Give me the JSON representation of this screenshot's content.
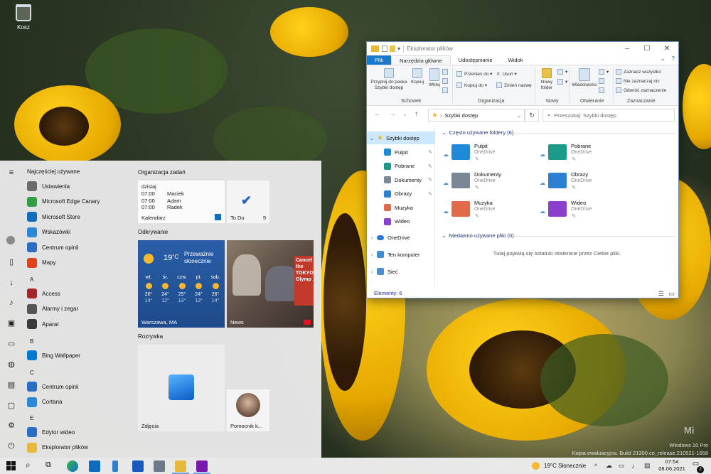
{
  "desktop": {
    "recycle_bin_label": "Kosz"
  },
  "watermark": {
    "line1": "Windows 10 Pro",
    "line2": "Kopia ewaluacyjna. Build 21390.co_release.210521-1658",
    "logo": "Mi"
  },
  "start_menu": {
    "most_used_heading": "Najczęściej używane",
    "apps": [
      {
        "label": "Ustawienia",
        "icon": "gear-icon",
        "color": "#6b6b6b"
      },
      {
        "label": "Microsoft Edge Canary",
        "icon": "edge-canary-icon",
        "color": "#2f9e44"
      },
      {
        "label": "Microsoft Store",
        "icon": "store-icon",
        "color": "#0f6cbd"
      },
      {
        "label": "Wskazówki",
        "icon": "tips-icon",
        "color": "#2b88d8"
      },
      {
        "label": "Centrum opinii",
        "icon": "feedback-icon",
        "color": "#2b6cc4"
      },
      {
        "label": "Mapy",
        "icon": "maps-icon",
        "color": "#e0421b"
      }
    ],
    "letter_a": "A",
    "apps_a": [
      {
        "label": "Access",
        "icon": "access-icon",
        "color": "#a4262c"
      },
      {
        "label": "Alarmy i zegar",
        "icon": "alarm-icon",
        "color": "#555555"
      },
      {
        "label": "Aparat",
        "icon": "camera-icon",
        "color": "#3a3a3a"
      }
    ],
    "letter_b": "B",
    "apps_b": [
      {
        "label": "Bing Wallpaper",
        "icon": "bing-icon",
        "color": "#0078d4"
      }
    ],
    "letter_c": "C",
    "apps_c": [
      {
        "label": "Centrum opinii",
        "icon": "feedback-icon",
        "color": "#2b6cc4"
      },
      {
        "label": "Cortana",
        "icon": "cortana-icon",
        "color": "#2b88d8"
      }
    ],
    "letter_e": "E",
    "apps_e": [
      {
        "label": "Edytor wideo",
        "icon": "video-editor-icon",
        "color": "#2b6cc4"
      },
      {
        "label": "Eksplorator plików",
        "icon": "folder-icon",
        "color": "#e8b83a"
      }
    ],
    "groups": {
      "organization": "Organizacja zadań",
      "discover": "Odkrywanie",
      "entertainment": "Rozrywka"
    },
    "calendar_tile": {
      "today": "dzisiaj",
      "events": [
        {
          "time": "07:00",
          "name": "Maciek"
        },
        {
          "time": "07:00",
          "name": "Adam"
        },
        {
          "time": "07:00",
          "name": "Radek"
        }
      ],
      "label": "Kalendarz"
    },
    "todo_tile": {
      "label": "To Do",
      "count": "9"
    },
    "weather_tile": {
      "temp": "19",
      "unit": "°C",
      "condition": "Przeważnie słonecznie",
      "days": [
        {
          "d": "wt.",
          "hi": "26°",
          "lo": "14°"
        },
        {
          "d": "śr.",
          "hi": "24°",
          "lo": "12°"
        },
        {
          "d": "czw.",
          "hi": "25°",
          "lo": "13°"
        },
        {
          "d": "pt.",
          "hi": "24°",
          "lo": "13°"
        },
        {
          "d": "sob.",
          "hi": "26°",
          "lo": "14°"
        }
      ],
      "location": "Warszawa, MA"
    },
    "news_tile": {
      "label": "News",
      "headline_text": "Cancel the TOKYO Olymp"
    },
    "photos_tile": {
      "label": "Zdjęcia"
    },
    "helper_tile": {
      "label": "Pomocnik k..."
    }
  },
  "explorer": {
    "title": "Eksplorator plików",
    "tabs": [
      "Plik",
      "Narzędzia główne",
      "Udostępnianie",
      "Widok"
    ],
    "ribbon": {
      "pin": "Przypnij do paska Szybki dostęp",
      "copy": "Kopiuj",
      "paste": "Wklej",
      "clipboard_group": "Schowek",
      "move_to": "Przenieś do",
      "copy_to": "Kopiuj do",
      "delete": "Usuń",
      "rename": "Zmień nazwę",
      "organize_group": "Organizacja",
      "new_folder": "Nowy folder",
      "new_group": "Nowy",
      "properties": "Właściwości",
      "open_group": "Otwieranie",
      "select_all": "Zaznacz wszystko",
      "select_none": "Nie zaznaczaj nic",
      "invert": "Odwróć zaznaczenie",
      "select_group": "Zaznaczanie"
    },
    "address": "Szybki dostęp",
    "search_placeholder": "Przeszukaj: Szybki dostęp",
    "nav": {
      "quick_access": "Szybki dostęp",
      "items": [
        {
          "label": "Pulpit",
          "color": "#1e8ad8"
        },
        {
          "label": "Pobrane",
          "color": "#1b9a8a"
        },
        {
          "label": "Dokumenty",
          "color": "#7a8796"
        },
        {
          "label": "Obrazy",
          "color": "#2d7fd1"
        },
        {
          "label": "Muzyka",
          "color": "#e06a4a"
        },
        {
          "label": "Wideo",
          "color": "#8a3fcf"
        }
      ],
      "onedrive": "OneDrive",
      "this_pc": "Ten komputer",
      "network": "Sieć"
    },
    "frequent_heading": "Często używane foldery (6)",
    "folders": [
      {
        "name": "Pulpit",
        "sub": "OneDrive",
        "color": "#1e8ad8"
      },
      {
        "name": "Pobrane",
        "sub": "OneDrive",
        "color": "#1b9a8a"
      },
      {
        "name": "Dokumenty",
        "sub": "OneDrive",
        "color": "#7a8796"
      },
      {
        "name": "Obrazy",
        "sub": "OneDrive",
        "color": "#2d7fd1"
      },
      {
        "name": "Muzyka",
        "sub": "OneDrive",
        "color": "#e06a4a"
      },
      {
        "name": "Wideo",
        "sub": "OneDrive",
        "color": "#8a3fcf"
      }
    ],
    "recent_heading": "Niedawno używane pliki (0)",
    "recent_empty": "Tutaj pojawią się ostatnio otwierane przez Ciebie pliki.",
    "status": "Elementy: 6"
  },
  "taskbar": {
    "weather": "19°C",
    "weather_desc": "Słonecznie",
    "time": "07:54",
    "date": "08.06.2021",
    "notif_count": "2"
  }
}
